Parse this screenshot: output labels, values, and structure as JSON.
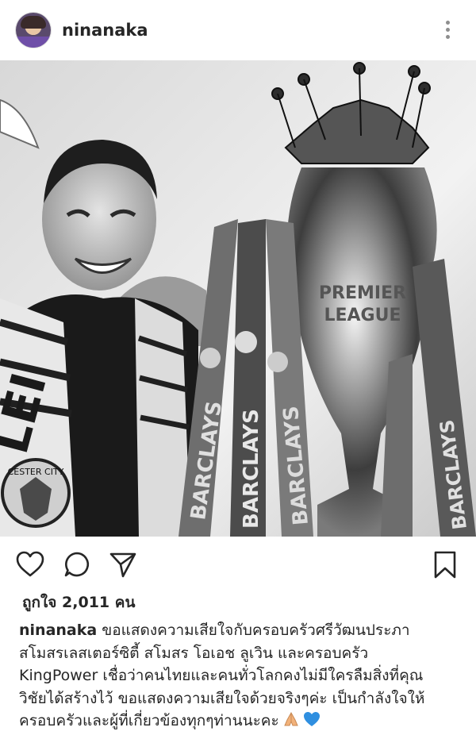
{
  "post": {
    "username": "ninanaka"
  },
  "header": {
    "more_icon": "more-options-icon"
  },
  "image": {
    "scarf_text": "LEI",
    "badge_text": "CESTER CITY",
    "ribbon_text": "BARCLAYS",
    "trophy_text_1": "PREMIER",
    "trophy_text_2": "LEAGUE"
  },
  "actions": {
    "like_icon": "heart-icon",
    "comment_icon": "comment-icon",
    "share_icon": "paper-plane-icon",
    "save_icon": "bookmark-icon"
  },
  "likes": {
    "label": "ถูกใจ 2,011 คน"
  },
  "caption": {
    "username": "ninanaka",
    "text": "ขอแสดงความเสียใจกับครอบครัวศรีวัฒนประภา\nสโมสรเลสเตอร์ซิตี้ สโมสร โอเอช ลูเวิน และครอบครัว\nKingPower เชื่อว่าคนไทยและคนทั่วโลกคงไม่มีใครลืมสิ่งที่คุณ\nวิชัยได้สร้างไว้ ขอแสดงความเสียใจด้วยจริงๆค่ะ เป็นกำลังใจให้\nครอบครัวและผู้ที่เกี่ยวข้องทุกๆท่านนะคะ",
    "emojis": [
      "folded-hands",
      "blue-heart"
    ]
  }
}
